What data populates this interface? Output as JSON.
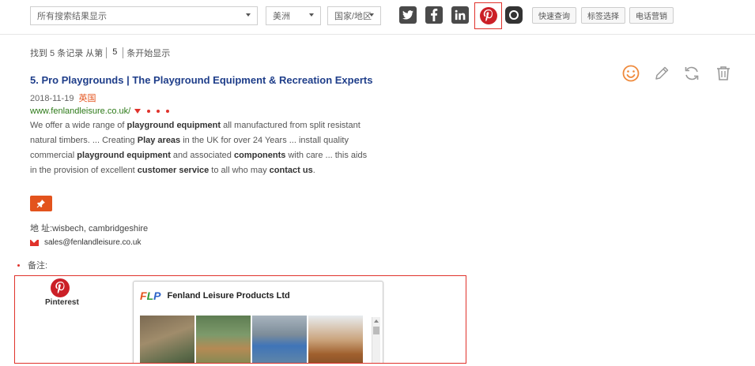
{
  "filters": {
    "search_placeholder": "所有搜索结果显示",
    "region": "美洲",
    "country": "国家/地区"
  },
  "social": {
    "twitter": "twitter-icon",
    "facebook": "facebook-icon",
    "linkedin": "linkedin-icon",
    "pinterest": "pinterest-icon",
    "instagram": "instagram-icon",
    "active": "pinterest"
  },
  "toolbar": {
    "btn1": "快速查询",
    "btn2": "标签选择",
    "btn3": "电话营销"
  },
  "status": {
    "prefix": "找到 5 条记录  从第",
    "page": "5",
    "suffix": "条开始显示"
  },
  "result": {
    "title": "5. Pro Playgrounds | The Playground Equipment & Recreation Experts",
    "date": "2018-11-19",
    "language": "英国",
    "url": "www.fenlandleisure.co.uk/",
    "description_html": "We offer a wide range of <b>playground equipment</b> all manufactured from split resistant natural timbers. ... Creating <b>Play areas</b> in the UK for over 24 Years ... install quality commercial <b>playground equipment</b> and associated <b>components</b> with care ... this aids in the provision of excellent <b>customer service</b> to all who may <b>contact us</b>.",
    "address": "地 址:wisbech, cambridgeshire",
    "email": "sales@fenlandleisure.co.uk",
    "note_label": "备注:"
  },
  "preview": {
    "source_label": "Pinterest",
    "company": "Fenland Leisure Products Ltd"
  },
  "colors": {
    "accent": "#e3531d",
    "title_blue": "#1f3e8a",
    "url_green": "#2d7a18",
    "highlight_red": "#e0322b"
  }
}
